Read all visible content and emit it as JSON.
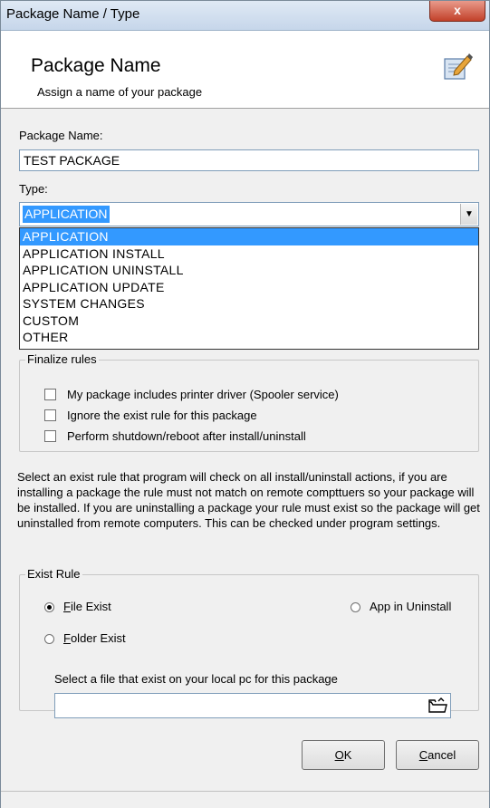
{
  "window": {
    "title": "Package Name / Type",
    "close_label": "x"
  },
  "header": {
    "title": "Package Name",
    "subtitle": "Assign a name of your package",
    "icon": "package-edit-icon"
  },
  "form": {
    "name_label": "Package Name:",
    "name_value": "TEST PACKAGE",
    "type_label": "Type:",
    "type_value": "APPLICATION",
    "type_options": [
      "APPLICATION",
      "APPLICATION INSTALL",
      "APPLICATION UNINSTALL",
      "APPLICATION UPDATE",
      "SYSTEM CHANGES",
      "CUSTOM",
      "OTHER"
    ]
  },
  "finalize": {
    "legend": "Finalize rules",
    "options": [
      {
        "label": "My package includes printer driver (Spooler service)",
        "checked": false
      },
      {
        "label": "Ignore the exist rule for this package",
        "checked": false
      },
      {
        "label": "Perform shutdown/reboot after install/uninstall",
        "checked": false
      }
    ]
  },
  "description": "Select an exist rule that program will check on all install/uninstall actions, if you are installing a package the rule must not match on remote compttuers so your package will be installed. If you are uninstalling a package your rule must exist so the package will get uninstalled from remote computers. This can be checked under program settings.",
  "exist_rule": {
    "legend": "Exist Rule",
    "file_exist": {
      "accel": "F",
      "rest": "ile Exist",
      "selected": true
    },
    "folder_exist": {
      "accel": "F",
      "rest": "older Exist",
      "selected": false
    },
    "app_uninstall": {
      "label": "App in Uninstall",
      "selected": false
    },
    "file_prompt": "Select a file that exist on your local pc for this package",
    "file_value": ""
  },
  "buttons": {
    "ok": {
      "accel": "O",
      "rest": "K"
    },
    "cancel": {
      "accel": "C",
      "rest": "ancel"
    }
  }
}
